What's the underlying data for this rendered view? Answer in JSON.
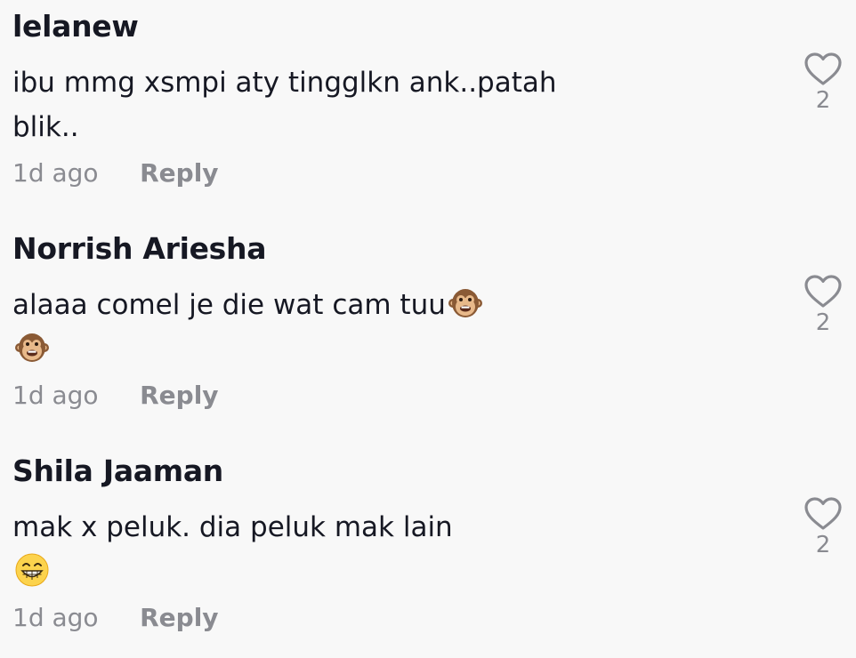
{
  "comments": [
    {
      "username": "lelanew",
      "text_lines": [
        "ibu mmg xsmpi aty tingglkn ank..patah",
        "blik.."
      ],
      "timestamp": "1d ago",
      "reply_label": "Reply",
      "like_count": "2",
      "emojis": []
    },
    {
      "username": "Norrish Ariesha",
      "text_lines": [
        "alaaa comel je die wat cam tuu",
        ""
      ],
      "timestamp": "1d ago",
      "reply_label": "Reply",
      "like_count": "2",
      "emojis": [
        "monkey-face",
        "monkey-face"
      ]
    },
    {
      "username": "Shila Jaaman",
      "text_lines": [
        "mak x peluk. dia peluk mak lain",
        ""
      ],
      "timestamp": "1d ago",
      "reply_label": "Reply",
      "like_count": "2",
      "emojis": [
        "grinning-face-with-smiling-eyes"
      ]
    }
  ],
  "icons": {
    "like": "heart-outline-icon"
  },
  "colors": {
    "background": "#f8f8f8",
    "username": "#161823",
    "text": "#161823",
    "muted": "#8a8b91"
  }
}
